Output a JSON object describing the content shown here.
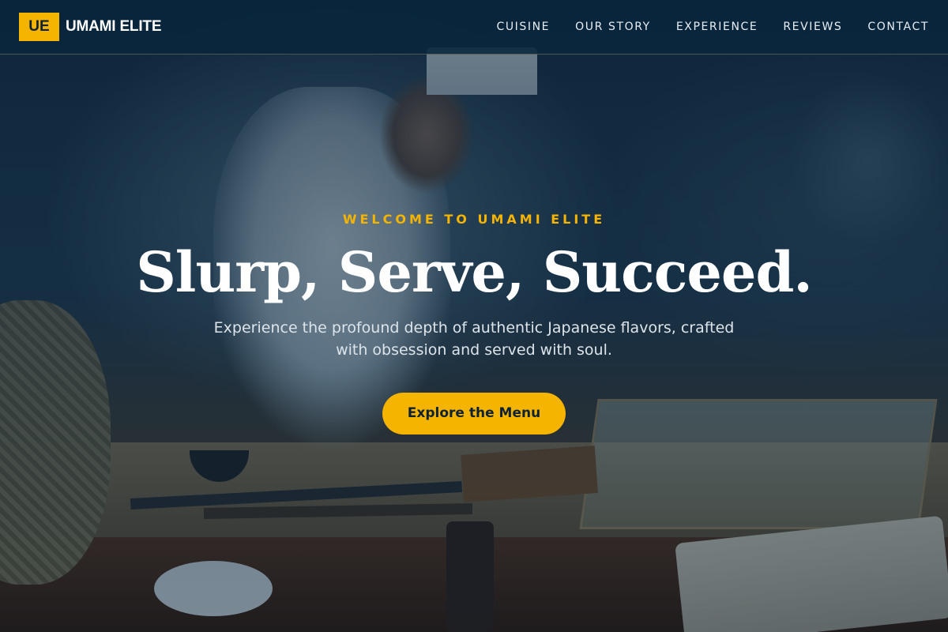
{
  "header": {
    "brand_mark": "UE",
    "brand_name": "UMAMI ELITE",
    "nav": [
      {
        "label": "CUISINE"
      },
      {
        "label": "OUR STORY"
      },
      {
        "label": "EXPERIENCE"
      },
      {
        "label": "REVIEWS"
      },
      {
        "label": "CONTACT"
      }
    ]
  },
  "hero": {
    "eyebrow": "WELCOME TO UMAMI ELITE",
    "headline": "Slurp, Serve, Succeed.",
    "subtitle": "Experience the profound depth of authentic Japanese flavors, crafted with obsession and served with soul.",
    "cta_label": "Explore the Menu",
    "background": "photo of sushi chef preparing food at a kitchen counter"
  },
  "colors": {
    "accent": "#f5b400",
    "header_bg": "#08263c",
    "overlay": "#061e34",
    "text_light": "#ffffff"
  }
}
